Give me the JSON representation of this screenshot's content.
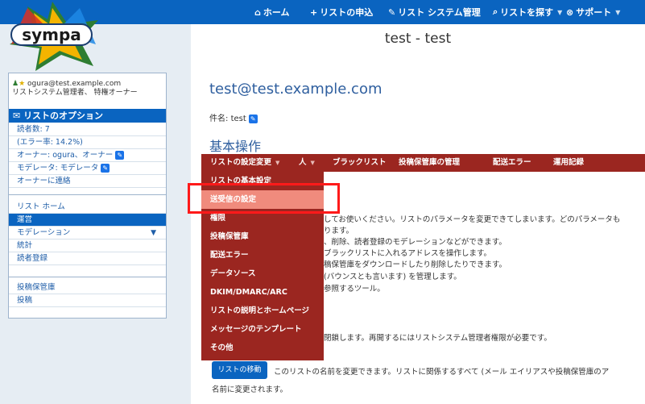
{
  "topnav": {
    "home": "ホーム",
    "request": "リストの申込",
    "admin": "リスト システム管理",
    "search": "リストを探す",
    "support": "サポート"
  },
  "page_title": "test - test",
  "sidebar": {
    "user_email": "ogura@test.example.com",
    "user_roles": "リストシステム管理者、 特権オーナー",
    "options_title": "リストのオプション",
    "subscribers": "読者数: 7",
    "error_rate": "(エラー率: 14.2%)",
    "owners": "オーナー: ogura、オーナー",
    "moderators": "モデレータ: モデレータ",
    "contact_owner": "オーナーに連絡",
    "items": [
      "リスト ホーム",
      "運営",
      "モデレーション",
      "統計",
      "読者登録"
    ],
    "archive_items": [
      "投稿保管庫",
      "投稿"
    ]
  },
  "main": {
    "list_email": "test@test.example.com",
    "subject_label": "件名:",
    "subject_value": "test",
    "section_title": "基本操作",
    "menu": [
      "リストの設定変更",
      "人",
      "ブラックリスト",
      "投稿保管庫の管理",
      "配送エラー",
      "運用記録"
    ],
    "dropdown": [
      "リストの基本設定",
      "送受信の設定",
      "権限",
      "投稿保管庫",
      "配送エラー",
      "データソース",
      "DKIM/DMARC/ARC",
      "リストの説明とホームページ",
      "メッセージのテンプレート",
      "その他"
    ],
    "partial_lines": [
      "してお使いください。リストのパラメータを変更できてしまいます。どのパラメータも",
      "ります。",
      "、削除、読者登録のモデレーションなどができます。",
      "ブラックリストに入れるアドレスを操作します。",
      "稿保管庫をダウンロードしたり削除したりできます。",
      "(バウンスとも言います) を管理します。",
      "参照するツール。"
    ],
    "close_text": "閉鎖します。再開するにはリストシステム管理者権限が必要です。",
    "rename_button": "リストの移動",
    "rename_text": "このリストの名前を変更できます。リストに関係するすべて (メール エイリアスや投稿保管庫のア",
    "rename_text2": "名前に変更されます。"
  },
  "colors": {
    "topbar": "#0a64c0",
    "menu": "#9b2620",
    "highlight": "#f08b7d",
    "callout": "#ff1a1a"
  }
}
